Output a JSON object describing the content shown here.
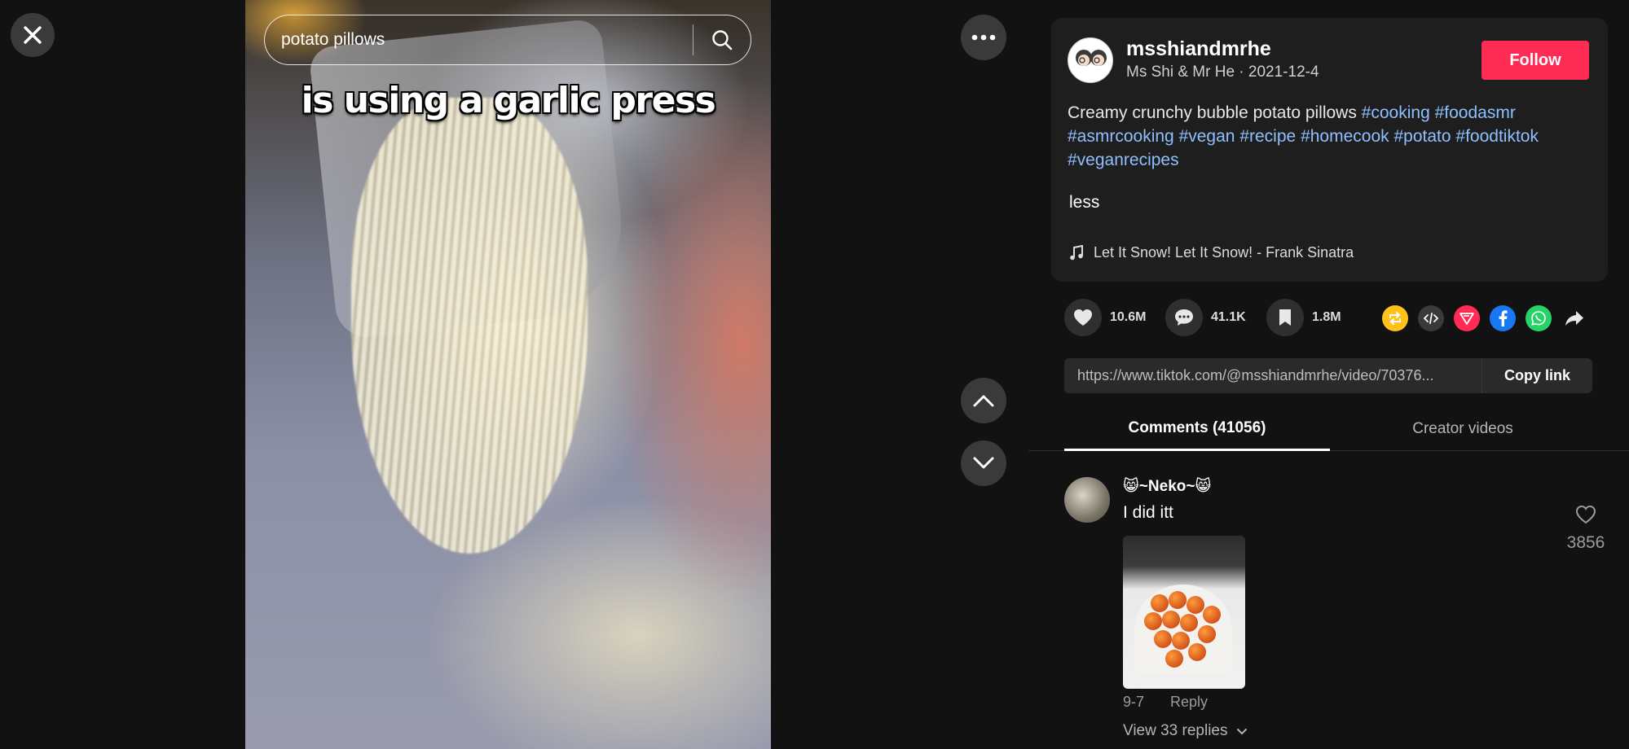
{
  "search": {
    "query": "potato pillows"
  },
  "video": {
    "caption": "is using a garlic press"
  },
  "author": {
    "username": "msshiandmrhe",
    "display_name": "Ms Shi & Mr He",
    "date": "2021-12-4",
    "subline": "Ms Shi & Mr He · 2021-12-4",
    "avatar_text": "Ms Shi & Mr He",
    "follow_label": "Follow"
  },
  "description": {
    "text": "Creamy crunchy bubble potato pillows",
    "hashtags": [
      "#cooking",
      "#foodasmr",
      "#asmrcooking",
      "#vegan",
      "#recipe",
      "#homecook",
      "#potato",
      "#foodtiktok",
      "#veganrecipes"
    ],
    "less_label": "less"
  },
  "music": {
    "title": "Let It Snow! Let It Snow! - Frank Sinatra"
  },
  "stats": {
    "likes": "10.6M",
    "comments": "41.1K",
    "saves": "1.8M"
  },
  "share_icons": [
    "repost-icon",
    "embed-icon",
    "send-to-friends-icon",
    "facebook-icon",
    "whatsapp-icon",
    "share-arrow-icon"
  ],
  "colors": {
    "follow": "#fe2c55",
    "hashtag": "#8fbfff",
    "repost": "#ffc21a",
    "send": "#fe2c55",
    "facebook": "#1877f2",
    "whatsapp": "#25d366"
  },
  "link": {
    "url": "https://www.tiktok.com/@msshiandmrhe/video/70376...",
    "copy_label": "Copy link"
  },
  "tabs": {
    "comments": "Comments (41056)",
    "creator": "Creator videos"
  },
  "comment": {
    "author": "😸~Neko~😸",
    "text": "I did itt",
    "likes": "3856",
    "date": "9-7",
    "reply_label": "Reply",
    "view_replies": "View 33 replies"
  }
}
